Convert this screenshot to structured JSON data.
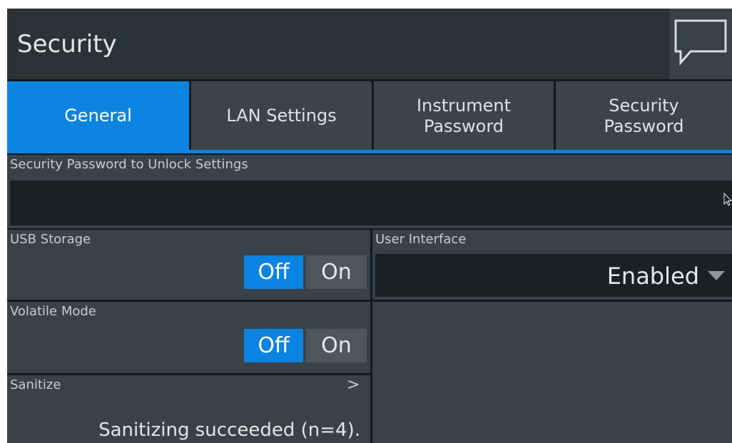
{
  "header": {
    "title": "Security",
    "help_icon": "speech-bubble-icon"
  },
  "tabs": [
    {
      "label": "General",
      "active": true
    },
    {
      "label": "LAN Settings",
      "active": false
    },
    {
      "label": "Instrument\nPassword",
      "active": false
    },
    {
      "label": "Security\nPassword",
      "active": false
    }
  ],
  "unlock": {
    "label": "Security Password to Unlock Settings",
    "value": ""
  },
  "usb_storage": {
    "label": "USB Storage",
    "off_label": "Off",
    "on_label": "On",
    "selected": "Off"
  },
  "user_interface": {
    "label": "User Interface",
    "value": "Enabled"
  },
  "volatile_mode": {
    "label": "Volatile Mode",
    "off_label": "Off",
    "on_label": "On",
    "selected": "Off"
  },
  "sanitize": {
    "label": "Sanitize",
    "chevron": ">",
    "status": "Sanitizing succeeded (n=4)."
  },
  "colors": {
    "accent": "#0a84e0",
    "panel": "#3a4249",
    "field": "#1b2024",
    "background": "#15191c"
  }
}
